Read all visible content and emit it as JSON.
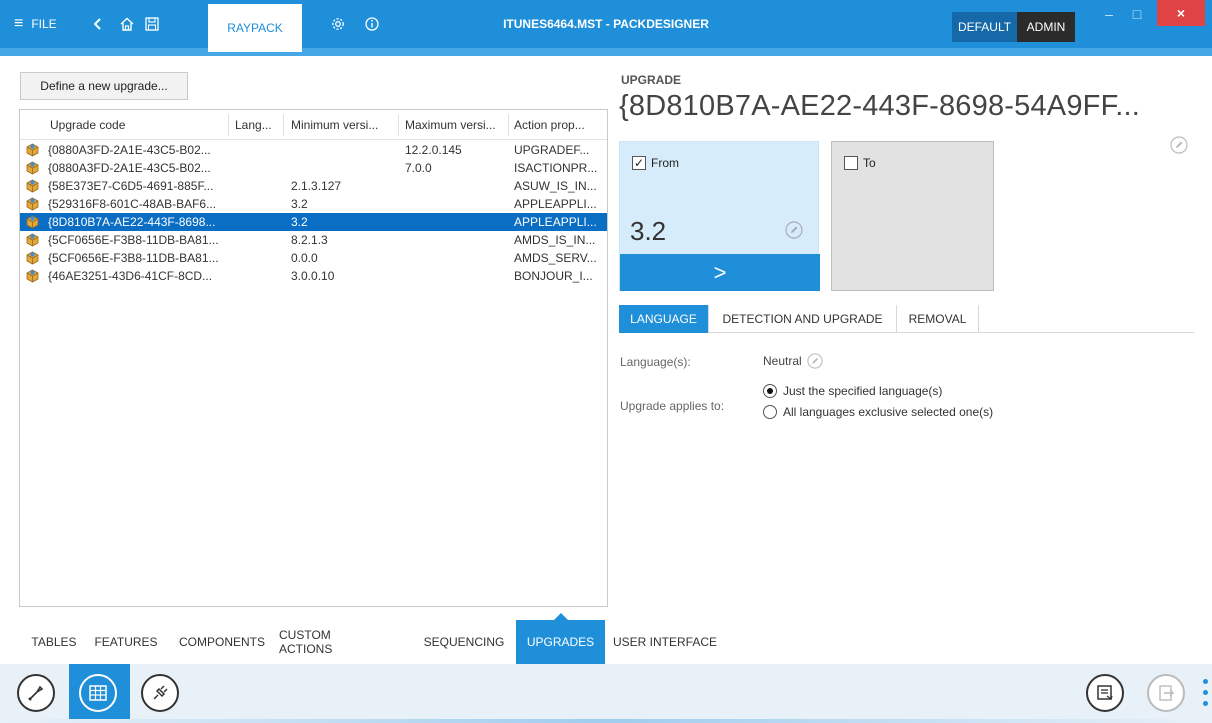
{
  "titlebar": {
    "file_label": "FILE",
    "raypack_tab": "RAYPACK",
    "window_title": "ITUNES6464.MST - PACKDESIGNER",
    "mode_default": "DEFAULT",
    "mode_admin": "ADMIN",
    "close_symbol": "×",
    "minimize_symbol": "–",
    "maximize_symbol": "□",
    "accent_color": "#1e8fd8"
  },
  "left": {
    "define_button": "Define a new upgrade...",
    "columns": [
      "Upgrade code",
      "Lang...",
      "Minimum versi...",
      "Maximum versi...",
      "Action prop..."
    ],
    "rows": [
      {
        "code": "{0880A3FD-2A1E-43C5-B02...",
        "lang": "",
        "min": "",
        "max": "12.2.0.145",
        "action": "UPGRADEF..."
      },
      {
        "code": "{0880A3FD-2A1E-43C5-B02...",
        "lang": "",
        "min": "",
        "max": "7.0.0",
        "action": "ISACTIONPR..."
      },
      {
        "code": "{58E373E7-C6D5-4691-885F...",
        "lang": "",
        "min": "2.1.3.127",
        "max": "",
        "action": "ASUW_IS_IN..."
      },
      {
        "code": "{529316F8-601C-48AB-BAF6...",
        "lang": "",
        "min": "3.2",
        "max": "",
        "action": "APPLEAPPLI..."
      },
      {
        "code": "{8D810B7A-AE22-443F-8698...",
        "lang": "",
        "min": "3.2",
        "max": "",
        "action": "APPLEAPPLI...",
        "selected": true
      },
      {
        "code": "{5CF0656E-F3B8-11DB-BA81...",
        "lang": "",
        "min": "8.2.1.3",
        "max": "",
        "action": "AMDS_IS_IN..."
      },
      {
        "code": "{5CF0656E-F3B8-11DB-BA81...",
        "lang": "",
        "min": "0.0.0",
        "max": "",
        "action": "AMDS_SERV..."
      },
      {
        "code": "{46AE3251-43D6-41CF-8CD...",
        "lang": "",
        "min": "3.0.0.10",
        "max": "",
        "action": "BONJOUR_I..."
      }
    ]
  },
  "detail": {
    "section_label": "UPGRADE",
    "code": "{8D810B7A-AE22-443F-8698-54A9FF...",
    "from_label": "From",
    "from_checked": true,
    "from_version": "3.2",
    "arrow": ">",
    "to_label": "To",
    "to_checked": false,
    "tabs": [
      "LANGUAGE",
      "DETECTION AND UPGRADE",
      "REMOVAL"
    ],
    "active_tab": "LANGUAGE",
    "languages_label": "Language(s):",
    "languages_value": "Neutral",
    "applies_label": "Upgrade applies to:",
    "applies_options": [
      "Just the specified language(s)",
      "All languages exclusive selected one(s)"
    ],
    "applies_selected": 0
  },
  "bottom_tabs": [
    "TABLES",
    "FEATURES",
    "COMPONENTS",
    "CUSTOM ACTIONS",
    "SEQUENCING",
    "UPGRADES",
    "USER INTERFACE"
  ],
  "bottom_active": "UPGRADES",
  "footer_icons": [
    "wrench-icon",
    "grid-icon",
    "plug-icon",
    "report-icon",
    "exit-icon",
    "more-icon"
  ]
}
